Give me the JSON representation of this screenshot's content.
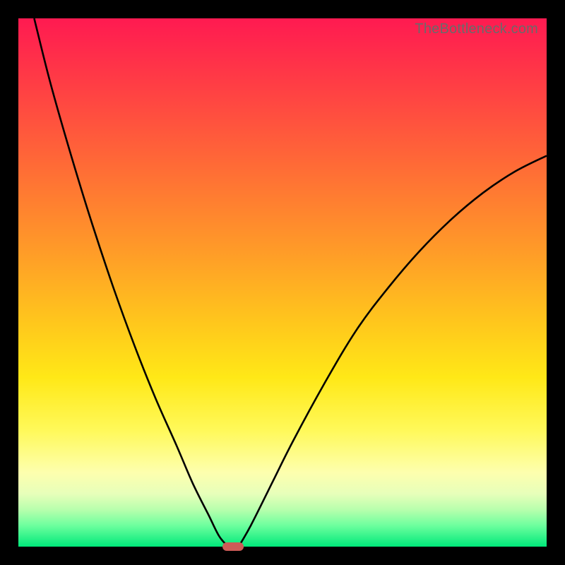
{
  "watermark": "TheBottleneck.com",
  "colors": {
    "curve": "#000000",
    "marker": "#cc5b57",
    "frame": "#000000"
  },
  "chart_data": {
    "type": "line",
    "title": "",
    "xlabel": "",
    "ylabel": "",
    "xlim": [
      0,
      100
    ],
    "ylim": [
      0,
      100
    ],
    "grid": false,
    "legend": false,
    "series": [
      {
        "name": "left-branch",
        "x": [
          3,
          6,
          10,
          14,
          18,
          22,
          26,
          30,
          33,
          36,
          38,
          39.7
        ],
        "y": [
          100,
          88,
          74,
          61,
          49,
          38,
          28,
          19,
          12,
          6,
          2,
          0
        ]
      },
      {
        "name": "right-branch",
        "x": [
          41.7,
          44,
          48,
          52,
          58,
          64,
          70,
          76,
          82,
          88,
          94,
          100
        ],
        "y": [
          0,
          4,
          12,
          20,
          31,
          41,
          49,
          56,
          62,
          67,
          71,
          74
        ]
      }
    ],
    "marker": {
      "x": 40.7,
      "y": 0,
      "width_frac": 0.04,
      "height_frac": 0.016
    },
    "gradient_stops": [
      {
        "pos": 0.0,
        "color": "#ff1a51"
      },
      {
        "pos": 0.12,
        "color": "#ff3c45"
      },
      {
        "pos": 0.28,
        "color": "#ff6b36"
      },
      {
        "pos": 0.44,
        "color": "#ff9b28"
      },
      {
        "pos": 0.58,
        "color": "#ffc81c"
      },
      {
        "pos": 0.68,
        "color": "#ffe817"
      },
      {
        "pos": 0.78,
        "color": "#fff95a"
      },
      {
        "pos": 0.86,
        "color": "#fdffae"
      },
      {
        "pos": 0.9,
        "color": "#e7ffba"
      },
      {
        "pos": 0.93,
        "color": "#b8ffad"
      },
      {
        "pos": 0.96,
        "color": "#6dff9e"
      },
      {
        "pos": 1.0,
        "color": "#00e87a"
      }
    ]
  }
}
